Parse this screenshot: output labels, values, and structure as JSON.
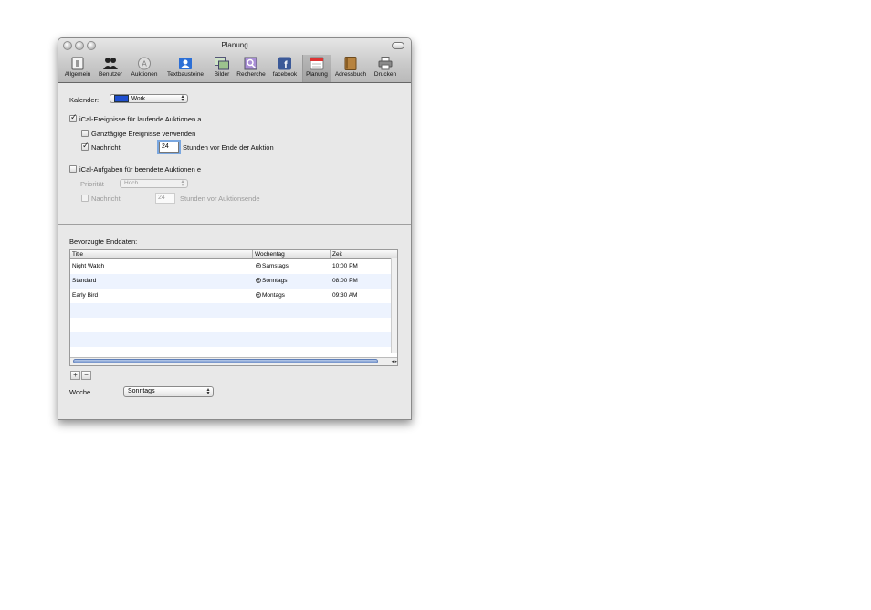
{
  "window": {
    "title": "Planung"
  },
  "toolbar": {
    "items": [
      {
        "label": "Allgemein",
        "icon": "switch-icon"
      },
      {
        "label": "Benutzer",
        "icon": "users-icon"
      },
      {
        "label": "Auktionen",
        "icon": "auction-icon"
      },
      {
        "label": "Textbausteine",
        "icon": "contact-card-icon"
      },
      {
        "label": "Bilder",
        "icon": "images-icon"
      },
      {
        "label": "Recherche",
        "icon": "search-icon"
      },
      {
        "label": "facebook",
        "icon": "facebook-icon"
      },
      {
        "label": "Planung",
        "icon": "calendar-icon",
        "selected": true
      },
      {
        "label": "Adressbuch",
        "icon": "address-book-icon"
      },
      {
        "label": "Drucken",
        "icon": "printer-icon"
      }
    ]
  },
  "calendar": {
    "label": "Kalender:",
    "value": "Work",
    "color": "#1f4fd0"
  },
  "ical_events": {
    "checkbox_label": "iCal-Ereignisse für laufende Auktionen a",
    "checked": true,
    "allday_label": "Ganztägige Ereignisse verwenden",
    "allday_checked": false,
    "notify_label": "Nachricht",
    "notify_checked": true,
    "hours_value": "24",
    "hours_suffix": "Stunden vor Ende der Auktion"
  },
  "ical_tasks": {
    "checkbox_label": "iCal-Aufgaben für beendete Auktionen e",
    "checked": false,
    "priority_label": "Priorität",
    "priority_value": "Hoch",
    "notify_label": "Nachricht",
    "hours_value": "24",
    "hours_suffix": "Stunden vor Auktionsende"
  },
  "preferred": {
    "label": "Bevorzugte Enddaten:",
    "columns": [
      "Title",
      "Wochentag",
      "Zeit"
    ],
    "rows": [
      {
        "title": "Night Watch",
        "weekday": "Samstags",
        "time": "10:00 PM"
      },
      {
        "title": "Standard",
        "weekday": "Sonntags",
        "time": "08:00 PM"
      },
      {
        "title": "Early Bird",
        "weekday": "Montags",
        "time": "09:30 AM"
      }
    ],
    "add_label": "+",
    "remove_label": "−"
  },
  "week": {
    "label": "Woche",
    "value": "Sonntags"
  }
}
